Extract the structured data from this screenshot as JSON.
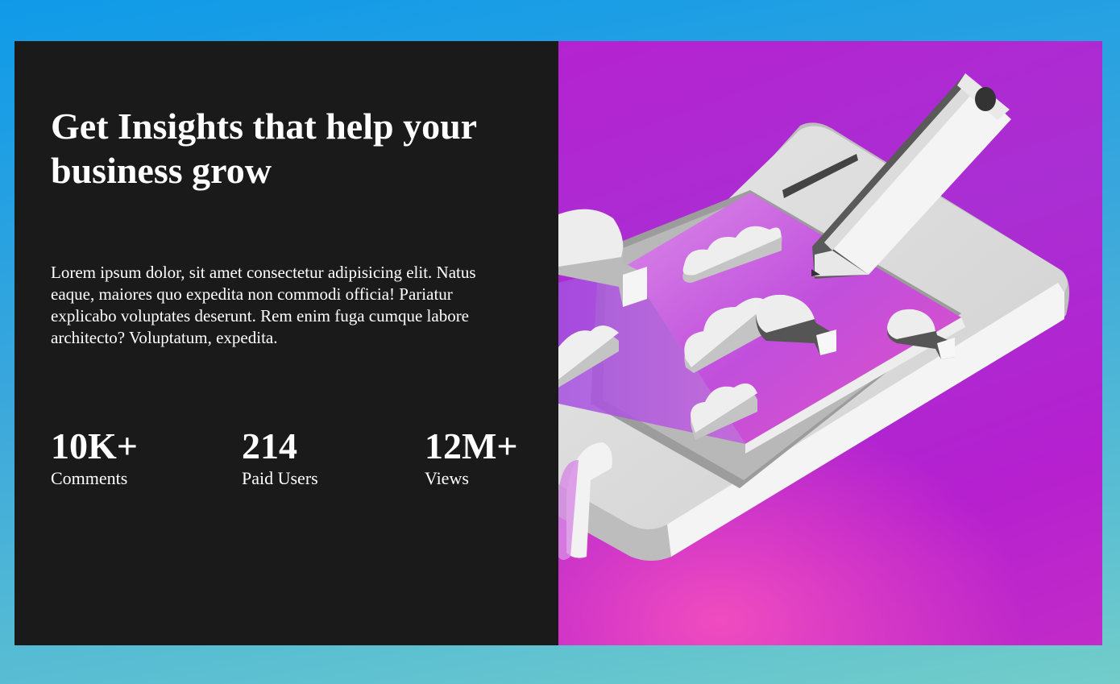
{
  "hero": {
    "title": "Get Insights that help your business grow",
    "description": "Lorem ipsum dolor, sit amet consectetur adipisicing elit. Natus eaque, maiores quo expedita non commodi officia! Pariatur explicabo voluptates deserunt. Rem enim fuga cumque labore architecto? Voluptatum, expedita."
  },
  "stats": [
    {
      "value": "10K+",
      "label": "Comments"
    },
    {
      "value": "214",
      "label": "Paid Users"
    },
    {
      "value": "12M+",
      "label": "Views"
    }
  ],
  "illustration": {
    "name": "isometric-tablet-illustration",
    "icons": [
      "pencil-icon",
      "cloud-icon",
      "lightbulb-icon"
    ]
  },
  "colors": {
    "page_bg_top": "#0f9ae8",
    "page_bg_bottom": "#72cdc9",
    "panel_bg": "#1a1a1a",
    "accent_purple": "#b423d0",
    "accent_pink": "#f04cbf"
  }
}
